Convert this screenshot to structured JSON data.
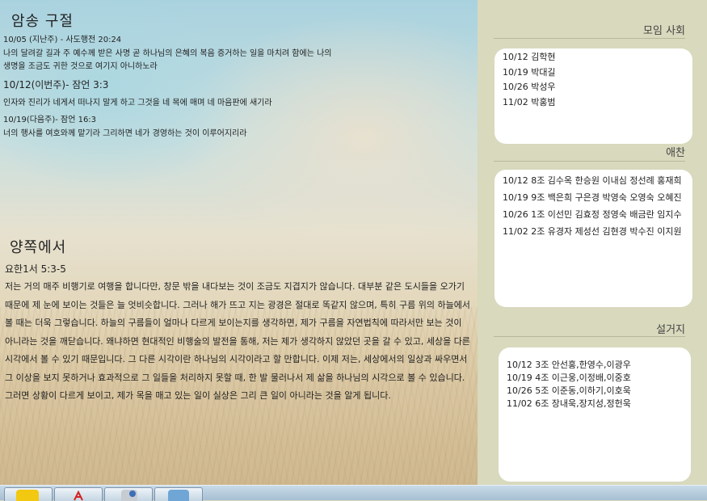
{
  "main": {
    "verse_title": "암송 구절",
    "verses": [
      "10/05 (지난주) - 사도행전 20:24",
      "나의 달려갈 길과 주 예수께 받은 사명 곧 하나님의 은혜의 복음 증거하는 일을 마치려 함에는 나의",
      "생명을 조금도 귀한 것으로 여기지 아니하노라",
      "10/12(이번주)- 잠언 3:3",
      "인자와 진리가 네게서 떠나지 말게 하고 그것을 네 목에 매며 네 마음판에 새기라",
      "10/19(다음주)- 잠언 16:3",
      "너의 행사를 여호와께 맡기라 그리하면 네가 경영하는 것이 이루어지리라"
    ],
    "essay_title": "양쪽에서",
    "essay_ref": "요한1서 5:3-5",
    "essay_body": "저는 거의 매주 비행기로 여행을 합니다만, 창문 밖을 내다보는 것이 조금도 지겹지가 않습니다. 대부분 같은 도시들을 오가기 때문에 제 눈에 보이는 것들은 늘 엇비슷합니다. 그러나 해가 뜨고 지는 광경은 절대로 똑같지 않으며, 특히 구름 위의 하늘에서 볼 때는 더욱 그렇습니다. 하늘의 구름들이 얼마나 다르게 보이는지를 생각하면, 제가 구름을 자연법칙에 따라서만 보는 것이 아니라는 것을 깨닫습니다. 왜냐하면 현대적인 비행술의 발전을 통해, 저는 제가 생각하지 않았던 곳을 갈 수 있고, 세상을 다른 시각에서 볼 수 있기 때문입니다. 그 다른 시각이란 하나님의 시각이라고 할 만합니다. 이제 저는, 세상에서의 일상과 싸우면서 그 이상을 보지 못하거나 효과적으로 그 일들을 처리하지 못할 때, 한 발 물러나서 제 삶을 하나님의 시각으로 볼 수 있습니다. 그러면 상황이 다르게 보이고, 제가 목을 매고 있는 일이 실상은 그리 큰 일이 아니라는 것을 알게 됩니다."
  },
  "sidebar": {
    "moim": {
      "heading": "모임 사회",
      "rows": [
        "10/12 김학현",
        "10/19 박대길",
        "10/26 박성우",
        "11/02 박홍범"
      ]
    },
    "aechan": {
      "heading": "애찬",
      "rows": [
        "10/12 8조 김수옥 한승원 이내심 정선례 홍재희",
        "10/19 9조 백은희 구은경 박영숙 오영숙 오혜진",
        "10/26 1조 이선민 김효정 정영숙 배금란 임지수",
        "11/02 2조 유경자 제성선 김현경 박수진 이지원"
      ]
    },
    "dishes": {
      "heading": "설거지",
      "rows": [
        "10/12 3조 안선홍,한영수,이광우",
        "10/19 4조 이근웅,이정배,이중호",
        "10/26 5조 이준동,이하기,이호욱",
        "11/02 6조 장내욱,장지성,정헌욱"
      ]
    }
  },
  "taskbar": {
    "items": [
      "talk-app-icon",
      "pdf-icon",
      "info-app-icon",
      "korean-app-icon"
    ],
    "colors": {
      "talk": "#f2c811",
      "pdf": "#d42323",
      "info": "#3b6fb6",
      "korean": "#6fa6d6"
    }
  }
}
